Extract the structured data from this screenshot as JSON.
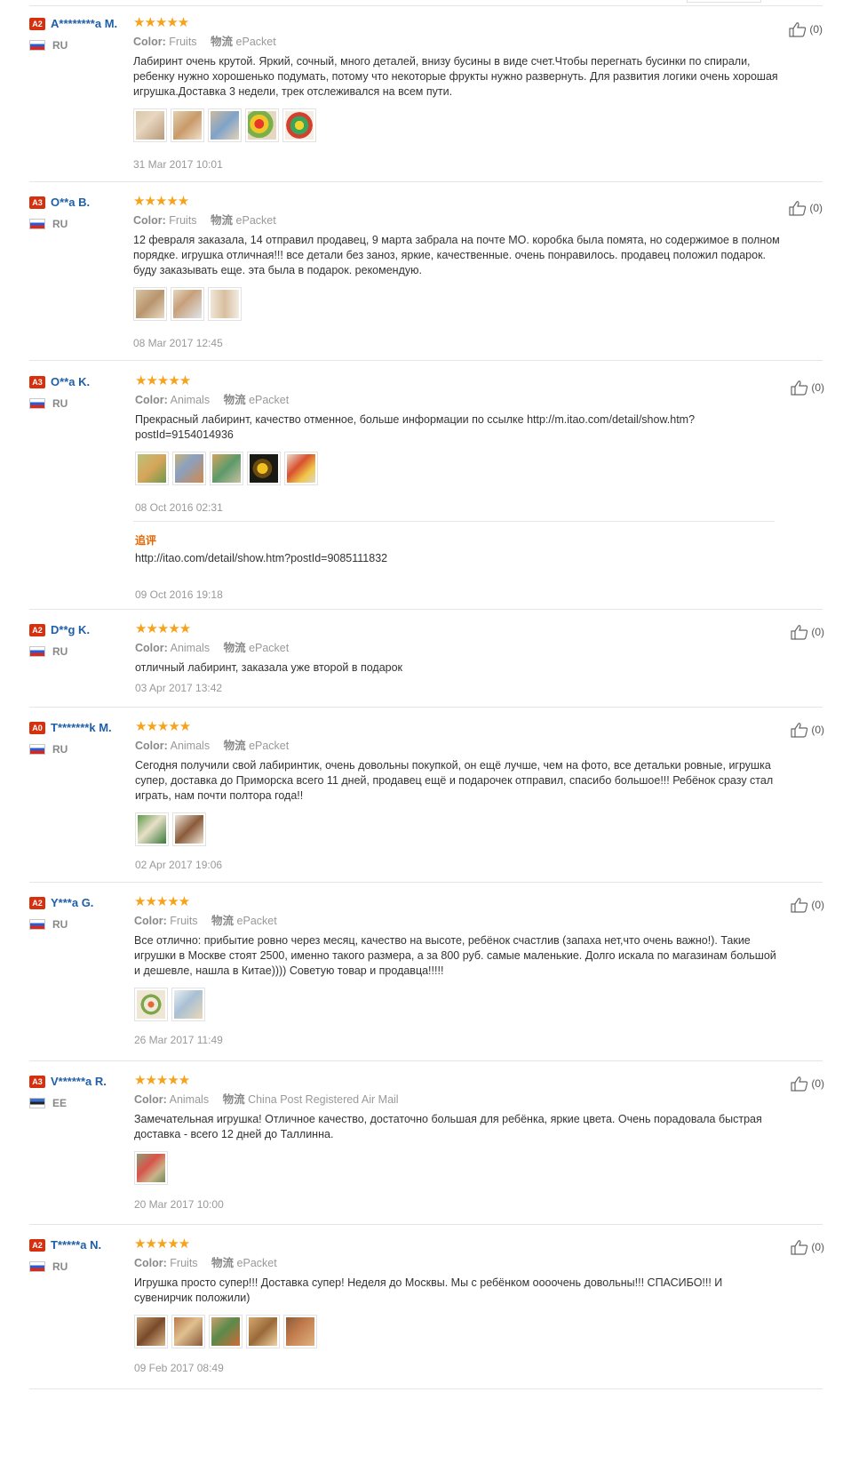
{
  "reviews": [
    {
      "level": "A2",
      "name": "A********a M.",
      "country": "RU",
      "color_label": "Color:",
      "color_value": "Fruits",
      "shipping_label": "物流",
      "shipping_value": "ePacket",
      "text": "Лабиринт очень крутой. Яркий, сочный, много деталей, внизу бусины в виде счет.Чтобы перегнать бусинки по спирали, ребенку нужно хорошенько подумать, потому что некоторые фрукты нужно развернуть. Для развития логики очень хорошая игрушка.Доставка 3 недели, трек отслеживался на всем пути.",
      "date": "31 Mar 2017 10:01",
      "likes": "(0)",
      "image_count": 5
    },
    {
      "level": "A3",
      "name": "O**a B.",
      "country": "RU",
      "color_label": "Color:",
      "color_value": "Fruits",
      "shipping_label": "物流",
      "shipping_value": "ePacket",
      "text": "12 февраля заказала, 14 отправил продавец, 9 марта забрала на почте МО. коробка была помята, но содержимое в полном порядке. игрушка отличная!!! все детали без заноз, яркие, качественные. очень понравилось. продавец положил подарок. буду заказывать еще. эта была в подарок. рекомендую.",
      "date": "08 Mar 2017 12:45",
      "likes": "(0)",
      "image_count": 3
    },
    {
      "level": "A3",
      "name": "O**a K.",
      "country": "RU",
      "color_label": "Color:",
      "color_value": "Animals",
      "shipping_label": "物流",
      "shipping_value": "ePacket",
      "text": "Прекрасный лабиринт, качество отменное, больше информации по ссылке http://m.itao.com/detail/show.htm?postId=9154014936",
      "date": "08 Oct 2016 02:31",
      "likes": "(0)",
      "image_count": 5,
      "followup_title": "追评",
      "followup_text": "http://itao.com/detail/show.htm?postId=9085111832",
      "followup_date": "09 Oct 2016 19:18"
    },
    {
      "level": "A2",
      "name": "D**g K.",
      "country": "RU",
      "color_label": "Color:",
      "color_value": "Animals",
      "shipping_label": "物流",
      "shipping_value": "ePacket",
      "text": "отличный лабиринт, заказала уже второй в подарок",
      "date": "03 Apr 2017 13:42",
      "likes": "(0)",
      "image_count": 0
    },
    {
      "level": "A0",
      "name": "T*******k M.",
      "country": "RU",
      "color_label": "Color:",
      "color_value": "Animals",
      "shipping_label": "物流",
      "shipping_value": "ePacket",
      "text": "Сегодня получили свой лабиринтик, очень довольны покупкой, он ещё лучше, чем на фото, все детальки ровные, игрушка супер, доставка до Приморска всего 11 дней, продавец ещё и подарочек отправил, спасибо большое!!! Ребёнок сразу стал играть, нам почти полтора года!!",
      "date": "02 Apr 2017 19:06",
      "likes": "(0)",
      "image_count": 2
    },
    {
      "level": "A2",
      "name": "Y***a G.",
      "country": "RU",
      "color_label": "Color:",
      "color_value": "Fruits",
      "shipping_label": "物流",
      "shipping_value": "ePacket",
      "text": "Все отлично: прибытие ровно через месяц, качество на высоте, ребёнок счастлив (запаха нет,что очень важно!). Такие игрушки в Москве стоят 2500, именно такого размера, а за 800 руб. самые маленькие. Долго искала по магазинам большой и дешевле, нашла в Китае)))) Советую товар и продавца!!!!!",
      "date": "26 Mar 2017 11:49",
      "likes": "(0)",
      "image_count": 2
    },
    {
      "level": "A3",
      "name": "V******a R.",
      "country": "EE",
      "color_label": "Color:",
      "color_value": "Animals",
      "shipping_label": "物流",
      "shipping_value": "China Post Registered Air Mail",
      "text": "Замечательная игрушка! Отличное качество, достаточно большая для ребёнка, яркие цвета. Очень порадовала быстрая доставка - всего 12 дней до Таллинна.",
      "date": "20 Mar 2017 10:00",
      "likes": "(0)",
      "image_count": 1
    },
    {
      "level": "A2",
      "name": "T*****a N.",
      "country": "RU",
      "color_label": "Color:",
      "color_value": "Fruits",
      "shipping_label": "物流",
      "shipping_value": "ePacket",
      "text": "Игрушка просто супер!!! Доставка супер! Неделя до Москвы. Мы с ребёнком оооочень довольны!!! СПАСИБО!!! И сувенирчик положили)",
      "date": "09 Feb 2017 08:49",
      "likes": "(0)",
      "image_count": 5
    }
  ],
  "star_glyphs": "★★★★★",
  "colors": {
    "accent_blue": "#1f5fa8",
    "star_orange": "#f6a21a",
    "badge_red": "#d7300f",
    "muted": "#999999"
  }
}
